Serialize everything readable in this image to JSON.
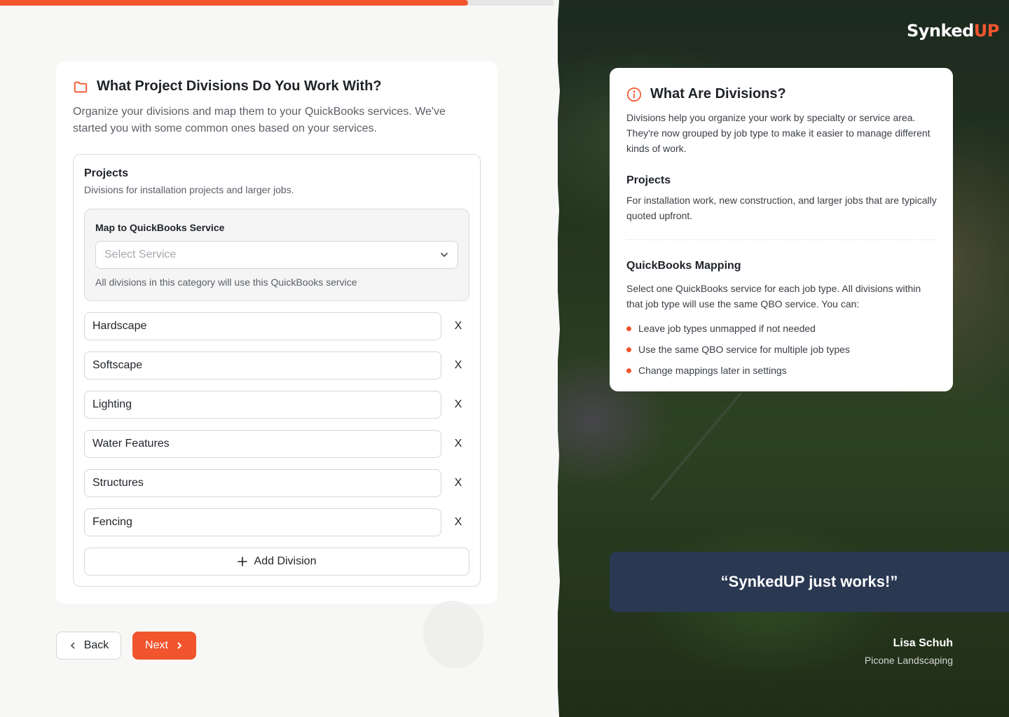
{
  "progress": {
    "fraction": 0.835
  },
  "main": {
    "title": "What Project Divisions Do You Work With?",
    "subtitle": "Organize your divisions and map them to your QuickBooks services. We've started you with some common ones based on your services.",
    "section": {
      "title": "Projects",
      "description": "Divisions for installation projects and larger jobs.",
      "mapping": {
        "label": "Map to QuickBooks Service",
        "select_placeholder": "Select Service",
        "help": "All divisions in this category will use this QuickBooks service"
      },
      "divisions": [
        {
          "value": "Hardscape",
          "remove": "X"
        },
        {
          "value": "Softscape",
          "remove": "X"
        },
        {
          "value": "Lighting",
          "remove": "X"
        },
        {
          "value": "Water Features",
          "remove": "X"
        },
        {
          "value": "Structures",
          "remove": "X"
        },
        {
          "value": "Fencing",
          "remove": "X"
        }
      ],
      "add_label": "Add Division"
    }
  },
  "nav": {
    "back_label": "Back",
    "next_label": "Next"
  },
  "brand": {
    "logo_part1": "Synked",
    "logo_part2": "UP"
  },
  "info": {
    "title": "What Are Divisions?",
    "intro": "Divisions help you organize your work by specialty or service area. They're now grouped by job type to make it easier to manage different kinds of work.",
    "projects_heading": "Projects",
    "projects_text": "For installation work, new construction, and larger jobs that are typically quoted upfront.",
    "mapping_heading": "QuickBooks Mapping",
    "mapping_text": "Select one QuickBooks service for each job type. All divisions within that job type will use the same QBO service. You can:",
    "bullets": [
      "Leave job types unmapped if not needed",
      "Use the same QBO service for multiple job types",
      "Change mappings later in settings"
    ]
  },
  "testimonial": {
    "quote": "“SynkedUP just works!”",
    "name": "Lisa Schuh",
    "company": "Picone Landscaping"
  },
  "colors": {
    "accent": "#f2542d",
    "quote_bg": "#2a3852"
  }
}
